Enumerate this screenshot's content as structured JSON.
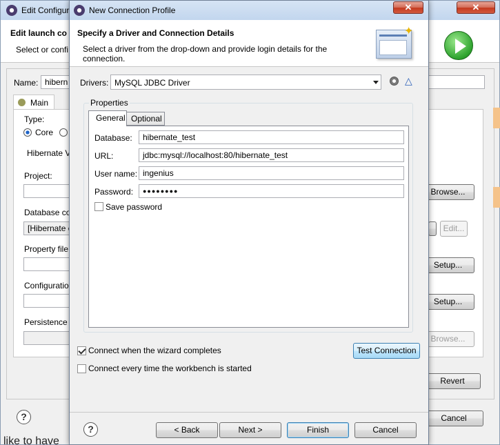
{
  "back_window": {
    "title": "Edit Configuration",
    "header_title": "Edit launch co",
    "header_sub": "Select or confi",
    "name_label": "Name:",
    "name_value": "hibern",
    "tab_main": "Main",
    "type_label": "Type:",
    "type_core": "Core",
    "hibernate_v": "Hibernate V",
    "project_label": "Project:",
    "db_conn_label": "Database co",
    "db_conn_value": "[Hibernate c",
    "property_file_label": "Property file",
    "configuration_label": "Configuratio",
    "persistence_label": "Persistence",
    "browse_1": "Browse...",
    "edit": "Edit...",
    "setup_1": "Setup...",
    "setup_2": "Setup...",
    "browse_2": "Browse...",
    "revert": "Revert",
    "cancel": "Cancel",
    "bottom_text": "like to have"
  },
  "dialog": {
    "title": "New Connection Profile",
    "header_title": "Specify a Driver and Connection Details",
    "header_sub": "Select a driver from the drop-down and provide login details for the connection.",
    "drivers_label": "Drivers:",
    "drivers_value": "MySQL JDBC Driver",
    "properties_label": "Properties",
    "tab_general": "General",
    "tab_optional": "Optional",
    "database_label": "Database:",
    "database_value": "hibernate_test",
    "url_label": "URL:",
    "url_value": "jdbc:mysql://localhost:80/hibernate_test",
    "username_label": "User name:",
    "username_value": "ingenius",
    "password_label": "Password:",
    "password_value": "●●●●●●●●",
    "save_password": "Save password",
    "connect_when_completes": "Connect when the wizard completes",
    "connect_every_time": "Connect every time the workbench is started",
    "test_connection": "Test Connection",
    "back": "< Back",
    "next": "Next >",
    "finish": "Finish",
    "cancel": "Cancel"
  },
  "checkbox_states": {
    "save_password": false,
    "connect_when_completes": true,
    "connect_every_time": false
  }
}
